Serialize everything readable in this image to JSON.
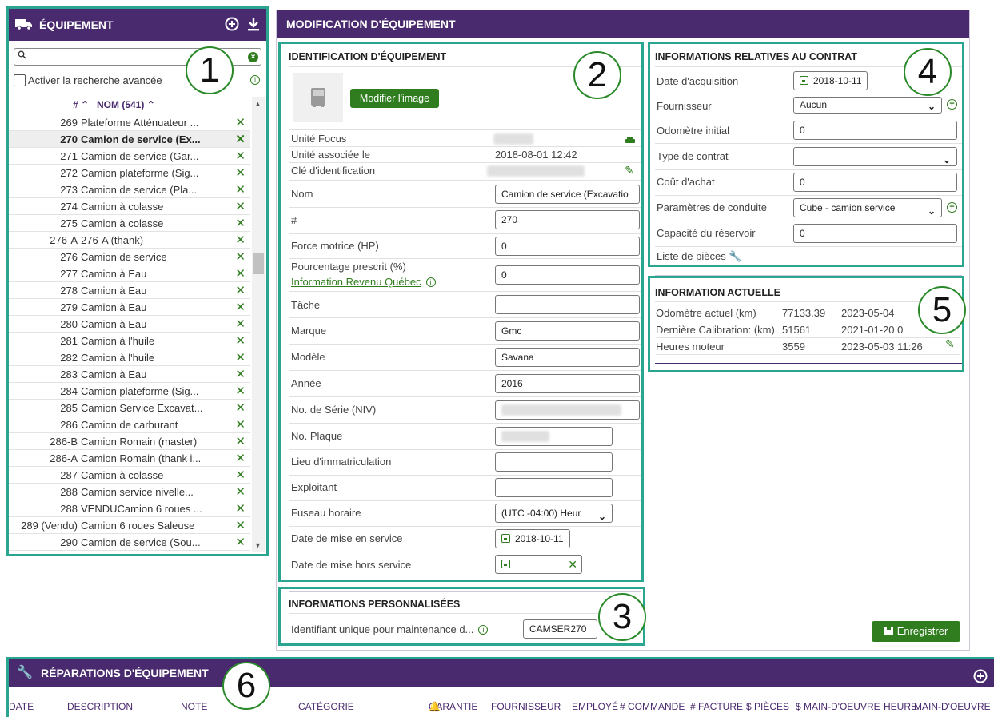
{
  "colors": {
    "header": "#4a2a6e",
    "accent": "#2f7d1e",
    "callout_border": "#2aa58f"
  },
  "left_panel": {
    "title": "ÉQUIPEMENT",
    "icons": [
      "truck-icon",
      "add-circle-icon",
      "download-icon"
    ],
    "search_placeholder": "",
    "advanced_search_label": "Activer la recherche avancée",
    "col_num": "#",
    "col_name": "NOM (541)",
    "rows": [
      {
        "num": "269",
        "name": "Plateforme Atténuateur ..."
      },
      {
        "num": "270",
        "name": "Camion de service (Ex..."
      },
      {
        "num": "271",
        "name": "Camion de service (Gar..."
      },
      {
        "num": "272",
        "name": "Camion plateforme (Sig..."
      },
      {
        "num": "273",
        "name": "Camion de service (Pla..."
      },
      {
        "num": "274",
        "name": "Camion à colasse"
      },
      {
        "num": "275",
        "name": "Camion à colasse"
      },
      {
        "num": "276-A",
        "name": "276-A (thank)"
      },
      {
        "num": "276",
        "name": "Camion de service"
      },
      {
        "num": "277",
        "name": "Camion à Eau"
      },
      {
        "num": "278",
        "name": "Camion à Eau"
      },
      {
        "num": "279",
        "name": "Camion à Eau"
      },
      {
        "num": "280",
        "name": "Camion à Eau"
      },
      {
        "num": "281",
        "name": "Camion à l'huile"
      },
      {
        "num": "282",
        "name": "Camion à l'huile"
      },
      {
        "num": "283",
        "name": "Camion à Eau"
      },
      {
        "num": "284",
        "name": "Camion plateforme (Sig..."
      },
      {
        "num": "285",
        "name": "Camion Service Excavat..."
      },
      {
        "num": "286",
        "name": "Camion de carburant"
      },
      {
        "num": "286-B",
        "name": "Camion Romain (master)"
      },
      {
        "num": "286-A",
        "name": "Camion Romain (thank i..."
      },
      {
        "num": "287",
        "name": "Camion à colasse"
      },
      {
        "num": "288",
        "name": "Camion service nivelle..."
      },
      {
        "num": "288",
        "name": "VENDUCamion 6 roues ..."
      },
      {
        "num": "289 (Vendu)",
        "name": "Camion 6 roues Saleuse"
      },
      {
        "num": "290",
        "name": "Camion de service (Sou..."
      }
    ],
    "selected_index": 1
  },
  "main": {
    "title": "MODIFICATION D'ÉQUIPEMENT",
    "identification": {
      "title": "IDENTIFICATION D'ÉQUIPEMENT",
      "modify_image": "Modifier l'image",
      "focus_unit": "Unité Focus",
      "associated_label": "Unité associée le",
      "associated_value": "2018-08-01 12:42",
      "id_key": "Clé d'identification",
      "name_label": "Nom",
      "name_value": "Camion de service (Excavatio",
      "num_label": "#",
      "num_value": "270",
      "hp_label": "Force motrice (HP)",
      "hp_value": "0",
      "pct_label": "Pourcentage prescrit (%)",
      "pct_link": "Information Revenu Québec",
      "pct_value": "0",
      "task_label": "Tâche",
      "task_value": "",
      "brand_label": "Marque",
      "brand_value": "Gmc",
      "model_label": "Modèle",
      "model_value": "Savana",
      "year_label": "Année",
      "year_value": "2016",
      "vin_label": "No. de Série (NIV)",
      "plate_label": "No. Plaque",
      "reg_label": "Lieu d'immatriculation",
      "reg_value": "",
      "operator_label": "Exploitant",
      "operator_value": "",
      "tz_label": "Fuseau horaire",
      "tz_value": "(UTC -04:00) Heur",
      "service_start_label": "Date de mise en service",
      "service_start_value": "2018-10-11",
      "service_end_label": "Date de mise hors service",
      "service_end_value": ""
    },
    "custom": {
      "title": "INFORMATIONS PERSONNALISÉES",
      "field_label": "Identifiant unique pour maintenance d...",
      "field_value": "CAMSER270"
    },
    "contract": {
      "title": "INFORMATIONS RELATIVES AU CONTRAT",
      "acq_label": "Date d'acquisition",
      "acq_value": "2018-10-11",
      "supplier_label": "Fournisseur",
      "supplier_value": "Aucun",
      "odo_label": "Odomètre initial",
      "odo_value": "0",
      "type_label": "Type de contrat",
      "type_value": "",
      "cost_label": "Coût d'achat",
      "cost_value": "0",
      "drive_label": "Paramètres de conduite",
      "drive_value": "Cube - camion service",
      "tank_label": "Capacité du réservoir",
      "tank_value": "0",
      "parts_label": "Liste de pièces"
    },
    "current": {
      "title": "INFORMATION ACTUELLE",
      "rows": [
        {
          "label": "Odomètre actuel  (km)",
          "value": "77133.39",
          "date": "2023-05-04"
        },
        {
          "label": "Dernière Calibration: (km)",
          "value": "51561",
          "date": "2021-01-20 0"
        },
        {
          "label": "Heures moteur",
          "value": "3559",
          "date": "2023-05-03 11:26"
        }
      ]
    },
    "save_label": "Enregistrer"
  },
  "repairs": {
    "title": "RÉPARATIONS D'ÉQUIPEMENT",
    "columns": [
      "DATE",
      "DESCRIPTION",
      "NOTE",
      "CATÉGORIE",
      "GARANTIE",
      "FOURNISSEUR",
      "EMPLOYÉ",
      "# COMMANDE",
      "# FACTURE",
      "$ PIÈCES",
      "$ MAIN-D'OEUVRE",
      "HEURE",
      "MAIN-D'OEUVRE"
    ]
  },
  "callouts": [
    "1",
    "2",
    "3",
    "4",
    "5",
    "6"
  ]
}
